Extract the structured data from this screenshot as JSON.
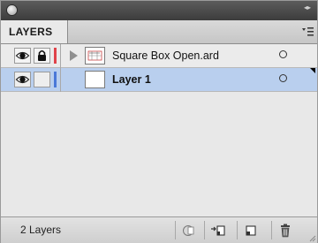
{
  "panel": {
    "tab_label": "LAYERS",
    "menu_icon": "panel-menu-icon"
  },
  "layers": [
    {
      "name": "Square Box Open.ard",
      "visible": true,
      "locked": true,
      "color": "#e0434a",
      "expandable": true,
      "selected": false
    },
    {
      "name": "Layer 1",
      "visible": true,
      "locked": false,
      "color": "#4a78d8",
      "expandable": false,
      "selected": true
    }
  ],
  "footer": {
    "count_label": "2 Layers",
    "buttons": [
      "make-clipping-mask-icon",
      "create-sublayer-icon",
      "create-new-layer-icon",
      "delete-layer-icon"
    ]
  }
}
